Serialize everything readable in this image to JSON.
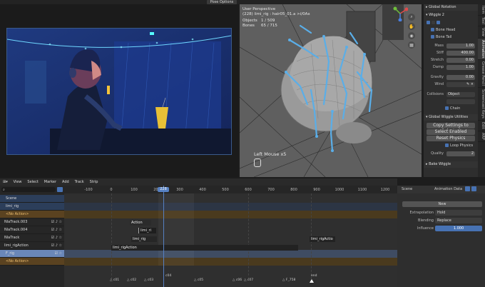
{
  "top": {
    "dropdown": "Pose Options"
  },
  "viewport": {
    "line1": "User Perspective",
    "line2": "(228) limi_rig : hair05_01.a >i/0Ax",
    "objects": "Objects",
    "objects_val": "1 / 509",
    "bones": "Bones",
    "bones_val": "65 / 715",
    "overlay": "Left Mouse x5"
  },
  "npanel": {
    "global_rotation": "Global Rotation",
    "wiggle2": "Wiggle 2",
    "bone_head": "Bone Head",
    "bone_tail": "Bone Tail",
    "props": [
      {
        "label": "Mass",
        "value": "1.00"
      },
      {
        "label": "Stiff",
        "value": "400.00"
      },
      {
        "label": "Stretch",
        "value": "0.00"
      },
      {
        "label": "Damp",
        "value": "1.00"
      },
      {
        "label": "Gravity",
        "value": "0.00"
      },
      {
        "label": "Wind",
        "value": ""
      }
    ],
    "collisions_label": "Collisions",
    "collisions_value": "Object",
    "chain": "Chain",
    "utilities": "Global Wiggle Utilities",
    "copy_settings": "Copy Settings to Selected",
    "select_enabled": "Select Enabled",
    "reset_physics": "Reset Physics",
    "loop_physics": "Loop Physics",
    "quality_label": "Quality",
    "quality_value": "2",
    "bake_wiggle": "Bake Wiggle",
    "tabs": [
      "Item",
      "Tool",
      "View",
      "Animation",
      "Grease Pencil",
      "Screencast Keys",
      "Edit",
      "ARP"
    ]
  },
  "nla": {
    "menus": [
      "View",
      "Select",
      "Marker",
      "Add",
      "Track",
      "Strip"
    ],
    "search_placeholder": "",
    "current_frame": "228",
    "ticks": [
      "-100",
      "0",
      "100",
      "200",
      "300",
      "400",
      "500",
      "600",
      "700",
      "800",
      "900",
      "1000",
      "1100",
      "1200"
    ],
    "tracks": [
      {
        "name": "Scene"
      },
      {
        "name": "limi_rig"
      },
      {
        "name": "<No Action>"
      },
      {
        "name": "NlaTrack.003"
      },
      {
        "name": "NlaTrack.004"
      },
      {
        "name": "NlaTrack"
      },
      {
        "name": "limi_rigAction"
      },
      {
        "name": "F_rig"
      },
      {
        "name": "<No Action>"
      }
    ],
    "strips": {
      "action": "Action",
      "limi_ri": "limi_ri",
      "limi_rig": "limi_rig",
      "limi_rigAction": "limi_rigAction",
      "limi_rigActio": "limi_rigActio"
    },
    "markers": [
      "c01",
      "c02",
      "c03",
      "c04",
      "c05",
      "c06",
      "c07",
      "F_758",
      "end"
    ]
  },
  "side": {
    "scene": "Scene",
    "animation_data": "Animation Data",
    "action_btn": "New",
    "extrapolation_label": "Extrapolation",
    "extrapolation_value": "Hold",
    "blending_label": "Blending",
    "blending_value": "Replace",
    "influence_label": "Influence",
    "influence_value": "1.000"
  },
  "colors": {
    "accent": "#4772b3",
    "bone": "#5aaee8",
    "playhead": "#5680c2"
  }
}
